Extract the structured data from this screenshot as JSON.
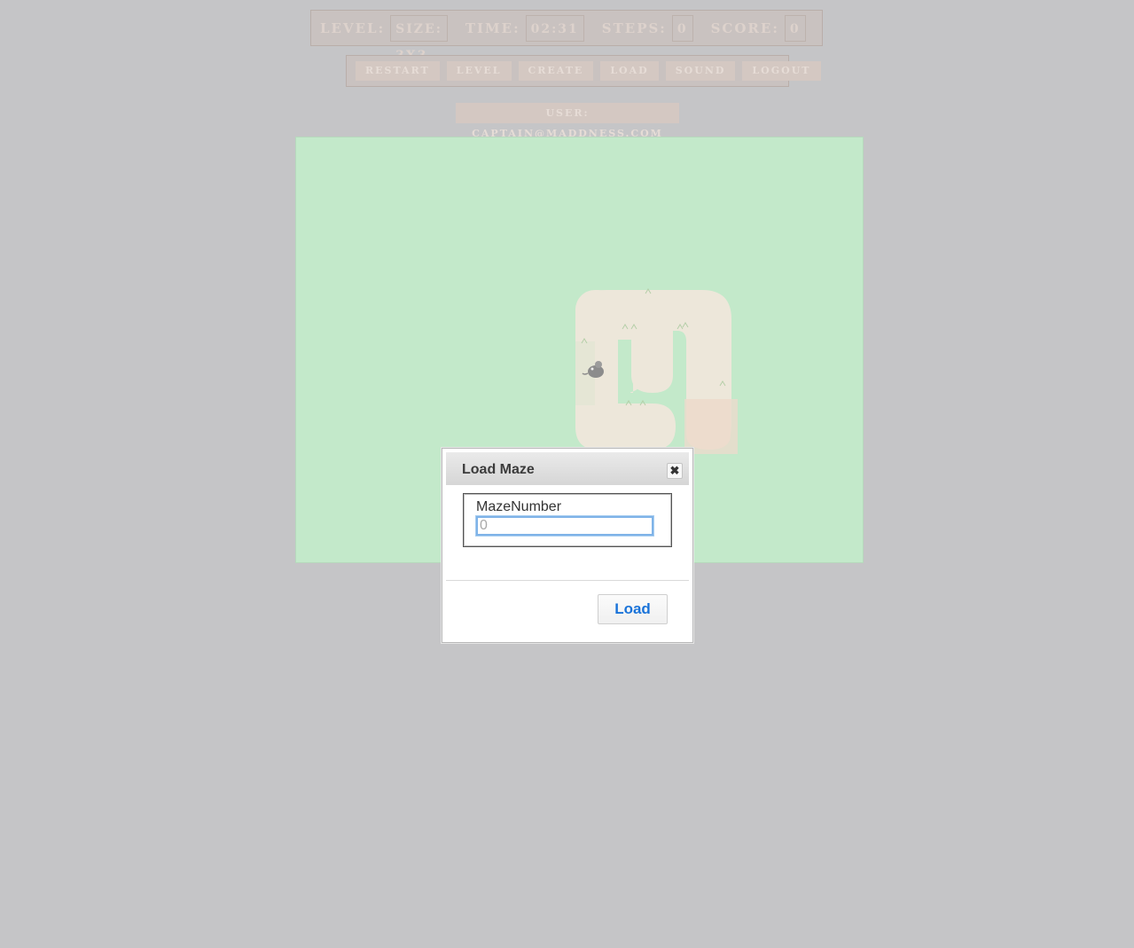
{
  "stats": {
    "level_label": "LEVEL:",
    "size_value": "SIZE: 3X3",
    "time_label": "TIME:",
    "time_value": "02:31",
    "steps_label": "STEPS:",
    "steps_value": "0",
    "score_label": "SCORE:",
    "score_value": "0"
  },
  "toolbar": {
    "restart": "RESTART",
    "level": "LEVEL",
    "create": "CREATE",
    "load": "LOAD",
    "sound": "SOUND",
    "logout": "LOGOUT"
  },
  "user": "USER: CAPTAIN@MADDNESS.COM",
  "board": {
    "background_color": "#c3e9ca",
    "path_color": "#ede7da",
    "exit_color": "#e9dccd",
    "player_icon": "mouse-icon"
  },
  "modal": {
    "title": "Load Maze",
    "close_icon": "close-icon",
    "field_label": "MazeNumber",
    "field_placeholder": "0",
    "load_button": "Load"
  }
}
